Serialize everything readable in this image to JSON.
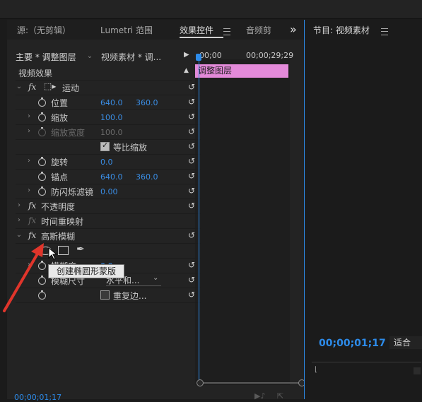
{
  "source_tab": "源:（无剪辑）",
  "lumetri_tab": "Lumetri 范围",
  "effects_tab": "效果控件",
  "audio_tab": "音频剪",
  "more_icon": "»",
  "master_label": "主要 * 调整图层",
  "sequence_label": "视频素材 * 调...",
  "timeline_start": "00;00",
  "timeline_end": "00;00;29;29",
  "clip_label": "调整图层",
  "video_effects": "视频效果",
  "motion": {
    "name": "运动",
    "icon": "transform-icon"
  },
  "position": {
    "label": "位置",
    "x": "640.0",
    "y": "360.0"
  },
  "scale": {
    "label": "缩放",
    "value": "100.0"
  },
  "scale_width": {
    "label": "缩放宽度",
    "value": "100.0"
  },
  "uniform_scale": "等比缩放",
  "rotation": {
    "label": "旋转",
    "value": "0.0"
  },
  "anchor": {
    "label": "锚点",
    "x": "640.0",
    "y": "360.0"
  },
  "anti_flicker": {
    "label": "防闪烁滤镜",
    "value": "0.00"
  },
  "opacity": "不透明度",
  "time_remap": "时间重映射",
  "gaussian_blur": "高斯模糊",
  "blurriness": {
    "label": "模糊度",
    "value": "0.0"
  },
  "blur_dimensions": {
    "label": "模糊尺寸",
    "value": "水平和..."
  },
  "repeat_edge": "重复边...",
  "tooltip": "创建椭圆形蒙版",
  "bottom_timecode": "00;00;01;17",
  "right_panel_title": "节目: 视频素材",
  "program_timecode": "00;00;01;17",
  "fit_label": "适合"
}
